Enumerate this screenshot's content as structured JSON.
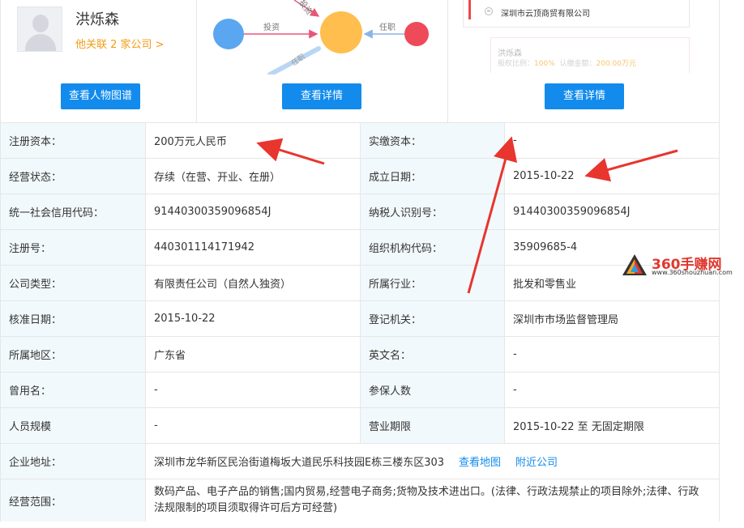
{
  "person": {
    "name": "洪烁森",
    "linked_companies": "他关联 2 家公司 >",
    "view_graph_button": "查看人物图谱"
  },
  "investment_graph": {
    "edge_invest_1": "投资",
    "edge_invest_2": "投资",
    "edge_position": "任职",
    "edge_position_2": "任职",
    "details_button": "查看详情",
    "colors": {
      "blue": "#5aa6f0",
      "orange": "#ffbe4d",
      "red": "#ee4a5a"
    }
  },
  "equity_structure": {
    "company_name": "深圳市云顶商贸有限公司",
    "shareholder_name": "洪烁森",
    "share_ratio_label": "股权比例：",
    "share_ratio": "100%",
    "subscribed_label": "认缴金额：",
    "subscribed_amount": "200.00万元",
    "details_button": "查看详情"
  },
  "info": {
    "reg_capital_label": "注册资本：",
    "reg_capital": "200万元人民币",
    "paid_capital_label": "实缴资本：",
    "paid_capital": "-",
    "status_label": "经营状态：",
    "status": "存续（在营、开业、在册）",
    "est_date_label": "成立日期：",
    "est_date": "2015-10-22",
    "credit_code_label": "统一社会信用代码：",
    "credit_code": "91440300359096854J",
    "taxpayer_id_label": "纳税人识别号：",
    "taxpayer_id": "91440300359096854J",
    "reg_no_label": "注册号：",
    "reg_no": "440301114171942",
    "org_code_label": "组织机构代码：",
    "org_code": "35909685-4",
    "company_type_label": "公司类型：",
    "company_type": "有限责任公司（自然人独资）",
    "industry_label": "所属行业：",
    "industry": "批发和零售业",
    "approval_date_label": "核准日期：",
    "approval_date": "2015-10-22",
    "reg_authority_label": "登记机关：",
    "reg_authority": "深圳市市场监督管理局",
    "region_label": "所属地区：",
    "region": "广东省",
    "english_name_label": "英文名：",
    "english_name": "-",
    "former_name_label": "曾用名：",
    "former_name": "-",
    "insured_label": "参保人数",
    "insured": "-",
    "staff_size_label": "人员规模",
    "staff_size": "-",
    "term_label": "营业期限",
    "term": "2015-10-22 至 无固定期限",
    "address_label": "企业地址：",
    "address": "深圳市龙华新区民治街道梅坂大道民乐科技园E栋三楼东区303",
    "view_map": "查看地图",
    "nearby": "附近公司",
    "scope_label": "经营范围：",
    "scope": "数码产品、电子产品的销售;国内贸易,经营电子商务;货物及技术进出口。(法律、行政法规禁止的项目除外;法律、行政法规限制的项目须取得许可后方可经营)"
  },
  "watermark": {
    "brand": "360手赚网",
    "url": "www.360shouzhuan.com"
  },
  "annotation_color": "#e8352e"
}
